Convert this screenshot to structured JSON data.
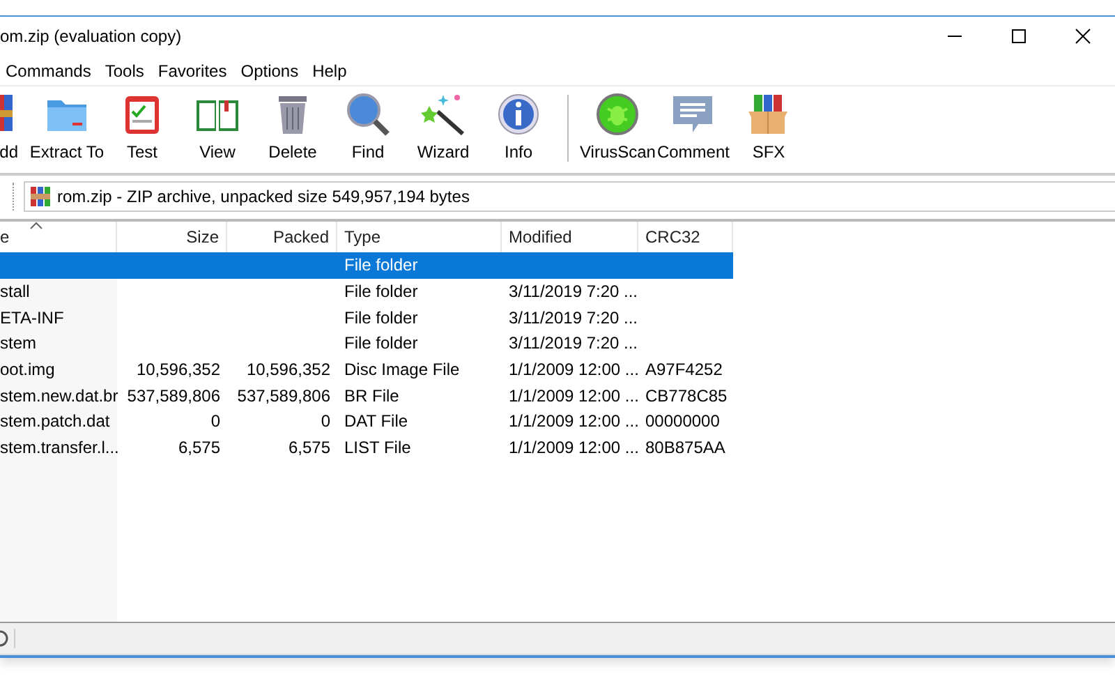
{
  "window": {
    "title": "om.zip (evaluation copy)"
  },
  "menu": [
    "Commands",
    "Tools",
    "Favorites",
    "Options",
    "Help"
  ],
  "toolbar_groups": [
    [
      {
        "label": "dd",
        "kind": "add"
      },
      {
        "label": "Extract To",
        "kind": "extract"
      },
      {
        "label": "Test",
        "kind": "test"
      },
      {
        "label": "View",
        "kind": "view"
      },
      {
        "label": "Delete",
        "kind": "delete"
      },
      {
        "label": "Find",
        "kind": "find"
      },
      {
        "label": "Wizard",
        "kind": "wizard"
      },
      {
        "label": "Info",
        "kind": "info"
      }
    ],
    [
      {
        "label": "VirusScan",
        "kind": "virusscan"
      },
      {
        "label": "Comment",
        "kind": "comment"
      },
      {
        "label": "SFX",
        "kind": "sfx"
      }
    ]
  ],
  "address": "rom.zip - ZIP archive, unpacked size 549,957,194 bytes",
  "table": {
    "columns": [
      {
        "label": "e",
        "kind": "text",
        "sorted": true
      },
      {
        "label": "Size",
        "kind": "number",
        "sorted": false
      },
      {
        "label": "Packed",
        "kind": "number",
        "sorted": false
      },
      {
        "label": "Type",
        "kind": "text",
        "sorted": false
      },
      {
        "label": "Modified",
        "kind": "text",
        "sorted": false
      },
      {
        "label": "CRC32",
        "kind": "text",
        "sorted": false
      }
    ],
    "rows": [
      {
        "type": "File folder",
        "selected": true
      },
      {
        "name": "stall",
        "type": "File folder",
        "modified": "3/11/2019 7:20 ...",
        "selected": false
      },
      {
        "name": "ETA-INF",
        "type": "File folder",
        "modified": "3/11/2019 7:20 ...",
        "selected": false
      },
      {
        "name": "stem",
        "type": "File folder",
        "modified": "3/11/2019 7:20 ...",
        "selected": false
      },
      {
        "name": "oot.img",
        "size": "10,596,352",
        "packed": "10,596,352",
        "type": "Disc Image File",
        "modified": "1/1/2009 12:00 ...",
        "crc": "A97F4252",
        "selected": false
      },
      {
        "name": "stem.new.dat.br",
        "size": "537,589,806",
        "packed": "537,589,806",
        "type": "BR File",
        "modified": "1/1/2009 12:00 ...",
        "crc": "CB778C85",
        "selected": false
      },
      {
        "name": "stem.patch.dat",
        "size": "0",
        "packed": "0",
        "type": "DAT File",
        "modified": "1/1/2009 12:00 ...",
        "crc": "00000000",
        "selected": false
      },
      {
        "name": "stem.transfer.l...",
        "size": "6,575",
        "packed": "6,575",
        "type": "LIST File",
        "modified": "1/1/2009 12:00 ...",
        "crc": "80B875AA",
        "selected": false
      }
    ]
  }
}
